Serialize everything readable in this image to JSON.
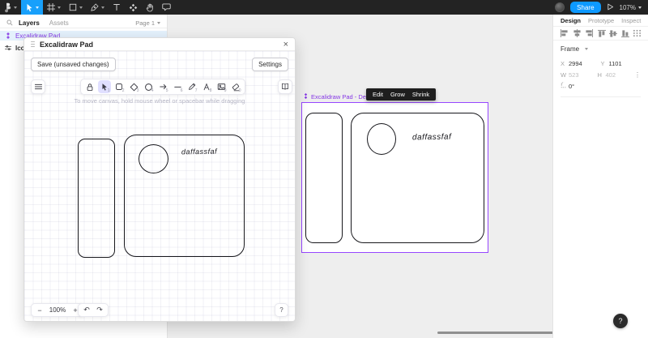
{
  "topbar": {
    "share": "Share",
    "zoom": "107%"
  },
  "left_sidebar": {
    "tabs": [
      "Layers",
      "Assets"
    ],
    "page": "Page 1",
    "layers": [
      {
        "name": "Excalidraw Pad",
        "selected": true
      },
      {
        "name": "Icon",
        "selected": false
      }
    ]
  },
  "modal": {
    "title": "Excalidraw Pad",
    "close": "×",
    "save": "Save (unsaved changes)",
    "settings": "Settings",
    "hint": "To move canvas, hold mouse wheel or spacebar while dragging",
    "canvas_text": "daffassfaf",
    "footer": {
      "zoom_out": "−",
      "zoom": "100%",
      "zoom_in": "+",
      "undo": "↶",
      "redo": "↷",
      "help": "?"
    }
  },
  "excalidraw_tools": [
    {
      "name": "lock",
      "shortcut": ""
    },
    {
      "name": "selection",
      "shortcut": "1",
      "active": true
    },
    {
      "name": "rectangle",
      "shortcut": "2"
    },
    {
      "name": "diamond",
      "shortcut": "3"
    },
    {
      "name": "ellipse",
      "shortcut": "4"
    },
    {
      "name": "arrow",
      "shortcut": "5"
    },
    {
      "name": "line",
      "shortcut": "6"
    },
    {
      "name": "draw",
      "shortcut": "7"
    },
    {
      "name": "text",
      "shortcut": "8"
    },
    {
      "name": "image",
      "shortcut": "9"
    },
    {
      "name": "eraser",
      "shortcut": "0"
    }
  ],
  "widget": {
    "label": "Excalidraw Pad - Details",
    "buttons": [
      "Edit",
      "Grow",
      "Shrink"
    ],
    "canvas_text": "daffassfaf"
  },
  "right_panel": {
    "tabs": [
      "Design",
      "Prototype",
      "Inspect"
    ],
    "section": "Frame",
    "props": {
      "x_label": "X",
      "x": "2994",
      "y_label": "Y",
      "y": "1101",
      "w_label": "W",
      "w": "523",
      "h_label": "H",
      "h": "402",
      "rotation": "0°"
    }
  },
  "help": {
    "label": "?"
  },
  "icons": {
    "figma-menu": "figma-logo",
    "move-tool": "cursor-arrow",
    "frame-tool": "frame-hash",
    "shape-tool": "square",
    "pen-tool": "pen-nib",
    "text-tool": "T",
    "component-tool": "four-diamonds",
    "hand-tool": "hand",
    "comment-tool": "speech-bubble",
    "present": "play-triangle",
    "search": "magnifier",
    "widget": "purple-widget-glyph",
    "library": "open-book",
    "menu": "hamburger-lines"
  },
  "colors": {
    "accent_blue": "#0d99ff",
    "tool_selected_blue": "#18a0fb",
    "widget_purple": "#9747ff",
    "layer_purple": "#8638e5",
    "excalidraw_active": "#e0dfff",
    "topbar_bg": "#232323"
  }
}
